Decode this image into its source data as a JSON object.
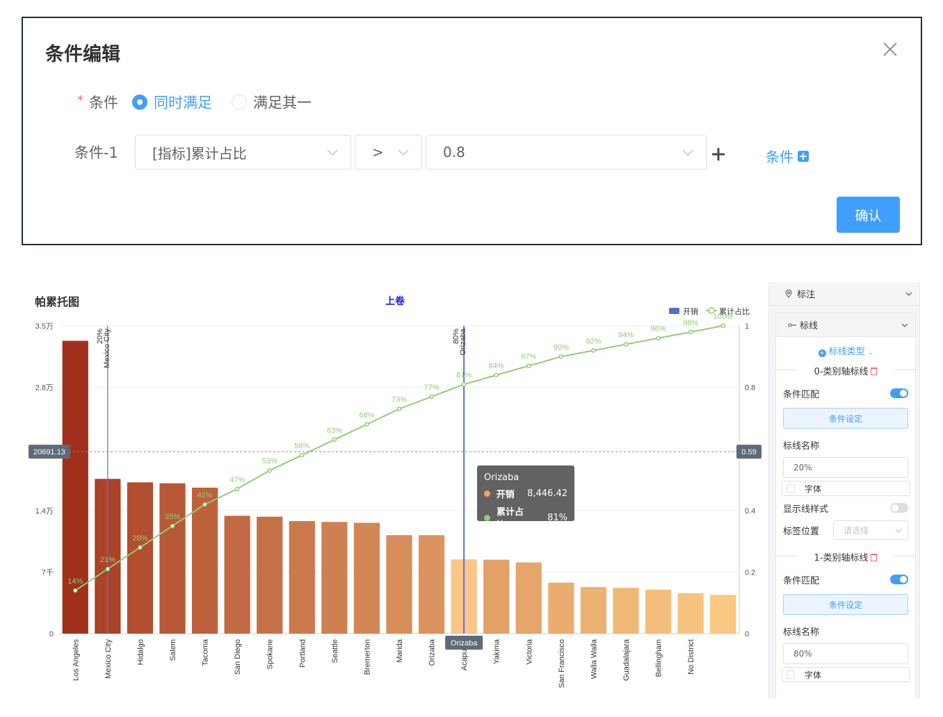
{
  "dialog": {
    "title": "条件编辑",
    "condition_label": "条件",
    "radio_all": "同时满足",
    "radio_any": "满足其一",
    "row_label": "条件-1",
    "field_value": "[指标]累计占比",
    "operator_value": ">",
    "threshold_value": "0.8",
    "add_condition": "条件",
    "confirm": "确认"
  },
  "chart": {
    "title": "帕累托图",
    "subtitle": "上卷",
    "legend": [
      "开销",
      "累计占比"
    ],
    "avg_label": "20691.13",
    "avg_label_right": "0.59",
    "x_pointer_label": "Orizaba",
    "marklines": [
      {
        "pct": "20%",
        "name": "Mexico City"
      },
      {
        "pct": "80%",
        "name": "Orizaba"
      }
    ],
    "tooltip": {
      "title": "Orizaba",
      "rows": [
        {
          "name": "开销",
          "value": "8,446.42",
          "color": "#f0a55f"
        },
        {
          "name": "累计占比",
          "value": "81%",
          "color": "#91cc75"
        }
      ]
    }
  },
  "chart_data": {
    "type": "bar",
    "categories": [
      "Los Angeles",
      "Mexico City",
      "Hidalgo",
      "Salem",
      "Tacoma",
      "San Diego",
      "Spokane",
      "Portland",
      "Seattle",
      "Bremerton",
      "Marida",
      "Orizaba",
      "Acapulco",
      "Yakima",
      "Victoria",
      "San Francisco",
      "Walla Walla",
      "Guadalajara",
      "Bellingham",
      "No District"
    ],
    "series": [
      {
        "name": "开销",
        "type": "bar",
        "values": [
          33300,
          17600,
          17200,
          17100,
          16600,
          13400,
          13300,
          12800,
          12700,
          12600,
          11200,
          11200,
          8446.42,
          8400,
          8100,
          5800,
          5300,
          5200,
          5000,
          4600,
          4400
        ]
      },
      {
        "name": "累计占比",
        "type": "line",
        "values": [
          0.14,
          0.21,
          0.28,
          0.35,
          0.42,
          0.47,
          0.53,
          0.58,
          0.63,
          0.68,
          0.73,
          0.77,
          0.81,
          0.84,
          0.87,
          0.9,
          0.92,
          0.94,
          0.96,
          0.98,
          1.0
        ],
        "labels": [
          "14%",
          "21%",
          "28%",
          "35%",
          "42%",
          "47%",
          "53%",
          "58%",
          "63%",
          "68%",
          "73%",
          "77%",
          "81%",
          "84%",
          "87%",
          "90%",
          "92%",
          "94%",
          "96%",
          "98%",
          "100%"
        ]
      }
    ],
    "y_ticks_left": [
      "0",
      "7千",
      "1.4万",
      "2.8万",
      "3.5万"
    ],
    "y_ticks_left_values": [
      0,
      7000,
      14000,
      28000,
      35000
    ],
    "ylim_left": [
      0,
      35000
    ],
    "y_ticks_right": [
      "0",
      "0.2",
      "0.4",
      "0.8",
      "1"
    ],
    "y_ticks_right_values": [
      0,
      0.2,
      0.4,
      0.8,
      1
    ],
    "ylim_right": [
      0,
      1
    ],
    "avg_line": 20691.13,
    "grid": true,
    "legend_position": "top-right"
  },
  "panel": {
    "section": "标注",
    "subsection": "标线",
    "line_type": "标线类型",
    "groups": [
      {
        "title": "0-类别轴标线",
        "match": "条件匹配",
        "set_btn": "条件设定",
        "name_label": "标线名称",
        "name_value": "20%",
        "font": "字体"
      },
      {
        "title": "1-类别轴标线",
        "match": "条件匹配",
        "set_btn": "条件设定",
        "name_label": "标线名称",
        "name_value": "80%",
        "font": "字体"
      }
    ],
    "show_style": "显示线样式",
    "label_pos": "标签位置",
    "label_pos_placeholder": "请选择"
  }
}
